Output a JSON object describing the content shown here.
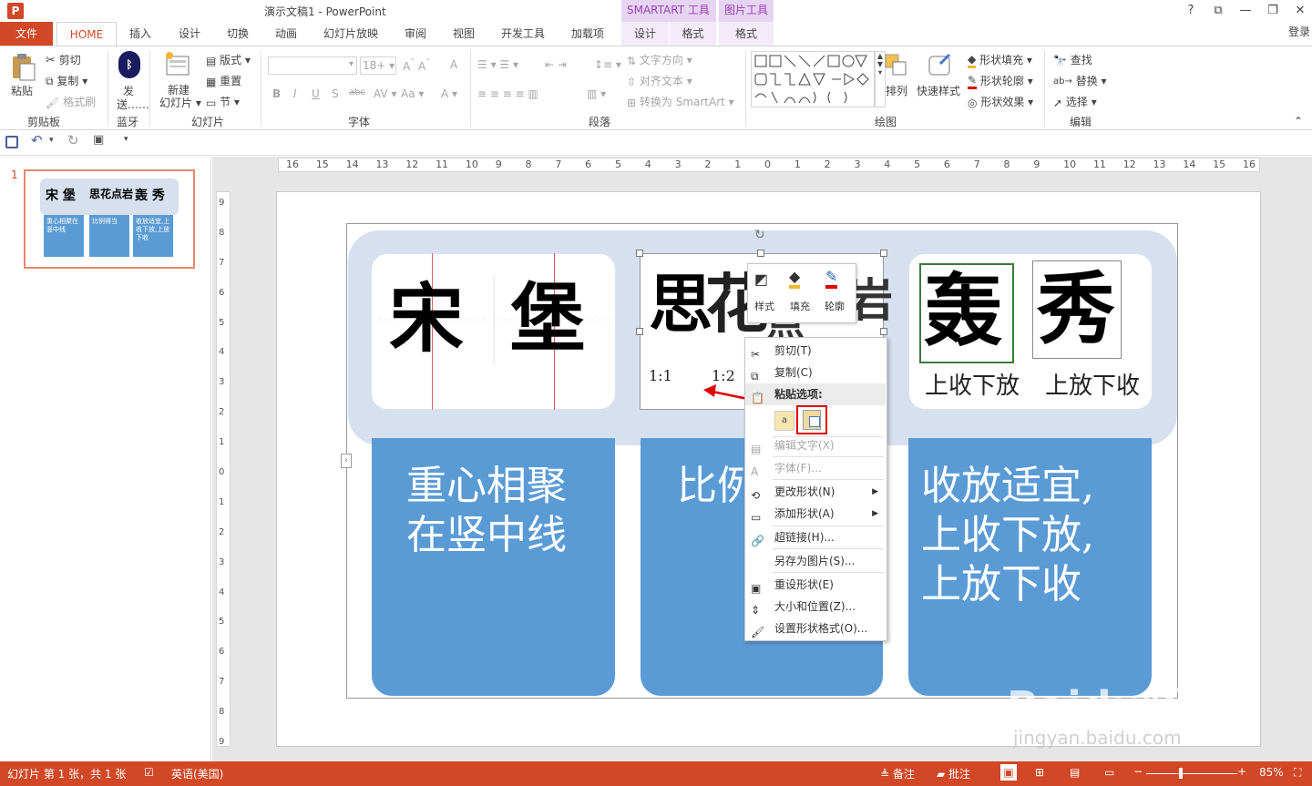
{
  "app": {
    "title": "演示文稿1 - PowerPoint",
    "icon": "P",
    "context_headers": [
      "SMARTART 工具",
      "图片工具"
    ],
    "login": "登录",
    "window_buttons": [
      "?",
      "⧉",
      "—",
      "❐",
      "✕"
    ]
  },
  "tabs": {
    "file": "文件",
    "home": "HOME",
    "items": [
      "插入",
      "设计",
      "切换",
      "动画",
      "幻灯片放映",
      "审阅",
      "视图",
      "开发工具",
      "加载项"
    ],
    "smartart_design": "设计",
    "smartart_format": "格式",
    "picture_format": "格式"
  },
  "ribbon": {
    "clipboard": {
      "paste": "粘贴",
      "cut": "剪切",
      "copy": "复制",
      "format_painter": "格式刷",
      "label": "剪贴板"
    },
    "bluetooth": {
      "send": "发",
      "send2": "送……",
      "label": "蓝牙"
    },
    "slides": {
      "new_slide": "新建",
      "new_slide2": "幻灯片",
      "layout": "版式",
      "reset": "重置",
      "section": "节",
      "label": "幻灯片"
    },
    "font": {
      "size": "18+",
      "label": "字体"
    },
    "paragraph": {
      "text_direction": "文字方向",
      "align_text": "对齐文本",
      "convert_smartart": "转换为 SmartArt",
      "label": "段落"
    },
    "drawing": {
      "arrange": "排列",
      "quick_styles": "快速样式",
      "shape_fill": "形状填充",
      "shape_outline": "形状轮廓",
      "shape_effects": "形状效果",
      "label": "绘图"
    },
    "editing": {
      "find": "查找",
      "replace": "替换",
      "select": "选择",
      "label": "编辑"
    }
  },
  "slide_panel": {
    "number": "1"
  },
  "thumbnail": {
    "t1": "重心相聚在竖中线",
    "t2": "比例得当",
    "t3": "收放适宜,上收下放,上放下收"
  },
  "ruler": {
    "h_ticks": [
      "16",
      "15",
      "14",
      "13",
      "12",
      "11",
      "10",
      "9",
      "8",
      "7",
      "6",
      "5",
      "4",
      "3",
      "2",
      "1",
      "0",
      "1",
      "2",
      "3",
      "4",
      "5",
      "6",
      "7",
      "8",
      "9",
      "10",
      "11",
      "12",
      "13",
      "14",
      "15",
      "16"
    ],
    "v_ticks": [
      "9",
      "8",
      "7",
      "6",
      "5",
      "4",
      "3",
      "2",
      "1",
      "0",
      "1",
      "2",
      "3",
      "4",
      "5",
      "6",
      "7",
      "8",
      "9"
    ]
  },
  "slide": {
    "chars1": [
      "宋",
      "堡"
    ],
    "chars2": [
      "思",
      "花",
      "点",
      "岩"
    ],
    "ratio_labels": [
      "1:1",
      "1:2"
    ],
    "chars3": [
      "轰",
      "秀"
    ],
    "captions3": [
      "上收下放",
      "上放下收"
    ],
    "card1": [
      "重心相聚",
      "在竖中线"
    ],
    "card2": [
      "比例"
    ],
    "card3": [
      "收放适宜,",
      "上收下放,",
      "上放下收"
    ]
  },
  "mini_toolbar": {
    "style": "样式",
    "fill": "填充",
    "outline": "轮廓"
  },
  "context_menu": {
    "cut": "剪切(T)",
    "copy": "复制(C)",
    "paste_options": "粘贴选项:",
    "edit_text": "编辑文字(X)",
    "font": "字体(F)...",
    "change_shape": "更改形状(N)",
    "add_shape": "添加形状(A)",
    "hyperlink": "超链接(H)...",
    "save_as_picture": "另存为图片(S)...",
    "reset_shape": "重设形状(E)",
    "size_position": "大小和位置(Z)...",
    "format_shape": "设置形状格式(O)..."
  },
  "status": {
    "slide_info": "幻灯片 第 1 张，共 1 张",
    "language": "英语(美国)",
    "notes": "备注",
    "comments": "批注",
    "zoom": "85%"
  },
  "watermark": {
    "brand": "Baidu经验",
    "url": "jingyan.baidu.com"
  },
  "colors": {
    "accent": "#d24726",
    "card": "#5b9bd5",
    "band": "#d6e0ef",
    "context": "#9b3fb5",
    "highlight": "#e00000"
  }
}
